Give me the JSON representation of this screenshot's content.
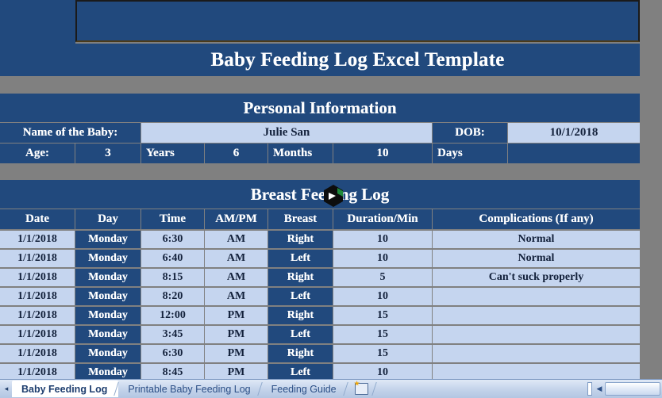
{
  "window": {
    "main_title": "Baby Feeding Log Excel Template"
  },
  "personal_information": {
    "section_title": "Personal Information",
    "name_label": "Name of the Baby:",
    "name_value": "Julie San",
    "dob_label": "DOB:",
    "dob_value": "10/1/2018",
    "age_label": "Age:",
    "years_value": "3",
    "years_label": "Years",
    "months_value": "6",
    "months_label": "Months",
    "days_value": "10",
    "days_label": "Days",
    "extra_value": ""
  },
  "breast_feeding_log": {
    "section_title": "Breast Feeding Log",
    "columns": [
      "Date",
      "Day",
      "Time",
      "AM/PM",
      "Breast",
      "Duration/Min",
      "Complications (If any)"
    ],
    "rows": [
      {
        "date": "1/1/2018",
        "day": "Monday",
        "time": "6:30",
        "ampm": "AM",
        "breast": "Right",
        "duration": "10",
        "complications": "Normal"
      },
      {
        "date": "1/1/2018",
        "day": "Monday",
        "time": "6:40",
        "ampm": "AM",
        "breast": "Left",
        "duration": "10",
        "complications": "Normal"
      },
      {
        "date": "1/1/2018",
        "day": "Monday",
        "time": "8:15",
        "ampm": "AM",
        "breast": "Right",
        "duration": "5",
        "complications": "Can't suck properly"
      },
      {
        "date": "1/1/2018",
        "day": "Monday",
        "time": "8:20",
        "ampm": "AM",
        "breast": "Left",
        "duration": "10",
        "complications": ""
      },
      {
        "date": "1/1/2018",
        "day": "Monday",
        "time": "12:00",
        "ampm": "PM",
        "breast": "Right",
        "duration": "15",
        "complications": ""
      },
      {
        "date": "1/1/2018",
        "day": "Monday",
        "time": "3:45",
        "ampm": "PM",
        "breast": "Left",
        "duration": "15",
        "complications": ""
      },
      {
        "date": "1/1/2018",
        "day": "Monday",
        "time": "6:30",
        "ampm": "PM",
        "breast": "Right",
        "duration": "15",
        "complications": ""
      },
      {
        "date": "1/1/2018",
        "day": "Monday",
        "time": "8:45",
        "ampm": "PM",
        "breast": "Left",
        "duration": "10",
        "complications": ""
      }
    ]
  },
  "sheet_tabs": {
    "prev_arrow": "◂",
    "tabs": [
      {
        "label": "Baby Feeding Log",
        "active": true
      },
      {
        "label": "Printable Baby Feeding Log",
        "active": false
      },
      {
        "label": "Feeding Guide",
        "active": false
      }
    ],
    "new_sheet_label": ""
  },
  "scrollbar": {
    "left_arrow": "◀"
  },
  "colors": {
    "dark_blue": "#21497D",
    "light_blue": "#C5D5EF",
    "grey": "#808080",
    "white": "#FFFFFF",
    "tab_text": "#2C4F86"
  }
}
